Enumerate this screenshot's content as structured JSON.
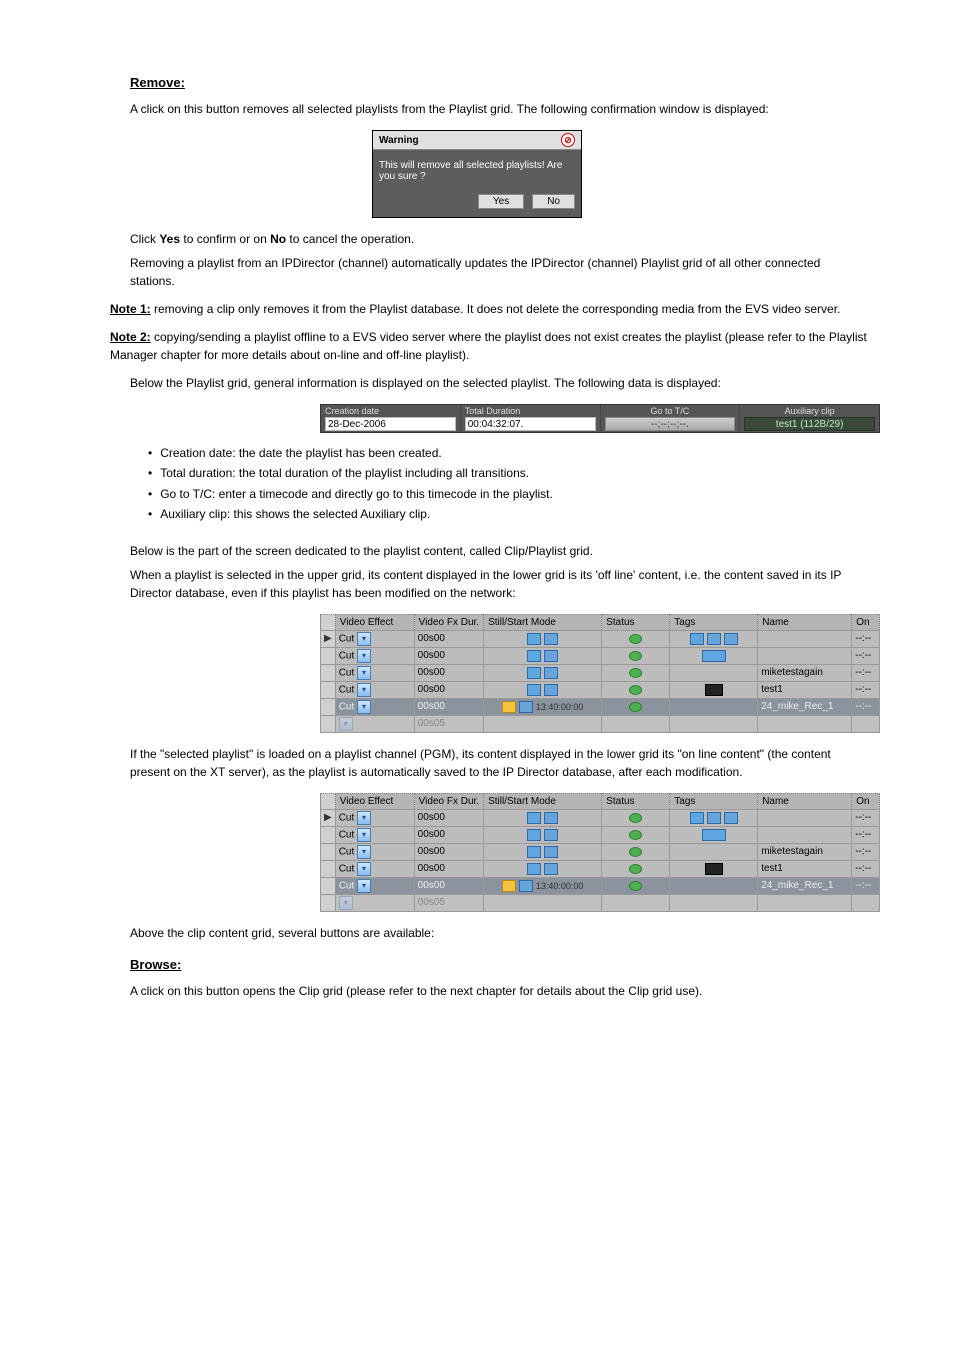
{
  "section_remove": {
    "heading": "Remove:",
    "p1": "A click on this button removes all selected playlists from the Playlist grid. The following confirmation window is displayed:",
    "warning": {
      "title": "Warning",
      "message": "This will remove all selected playlists! Are you sure ?",
      "yes": "Yes",
      "no": "No"
    },
    "p2_1": "Click ",
    "p2_yes": "Yes",
    "p2_2": " to confirm or on ",
    "p2_no": "No",
    "p2_3": " to cancel the operation.",
    "p3": "Removing a playlist from an IPDirector (channel) automatically updates the IPDirector (channel) Playlist grid of all other connected stations.",
    "note1_label": "Note 1:",
    "note1_text": " removing a clip only removes it from the Playlist database. It does not delete the corresponding media from the EVS video server.",
    "note2_label": "Note 2:",
    "note2_text": " copying/sending a playlist offline to a EVS video server where the playlist does not exist creates the playlist (please refer to the Playlist Manager chapter for more details about on-line and off-line playlist).",
    "p4": "Below the Playlist grid, general information is displayed on the selected playlist. The following data is displayed:",
    "infobar": {
      "creation_label": "Creation date",
      "creation_value": "28-Dec-2006",
      "total_label": "Total Duration",
      "total_value": "00:04:32:07.",
      "goto_label": "Go to T/C",
      "goto_value": "--;--;--;--.",
      "aux_label": "Auxiliary clip",
      "aux_value": "test1  (112B/29)"
    },
    "bullets": {
      "b1": "Creation date: the date the playlist has been created.",
      "b2": "Total duration: the total duration of the playlist including all transitions.",
      "b3": "Go to T/C: enter a timecode and directly go to this timecode in the playlist.",
      "b4": "Auxiliary clip: this shows the selected Auxiliary clip."
    }
  },
  "section_playlist": {
    "p1": "Below is the part of the screen dedicated to the playlist content, called Clip/Playlist grid.",
    "p2": "When a playlist is selected in the upper grid, its content displayed in the lower grid is its 'off line' content, i.e. the content saved in its IP Director database, even if this playlist has been modified on the network:",
    "p3": "If the \"selected playlist\" is loaded on a playlist channel (PGM), its content displayed in the lower grid its \"on line content\" (the content present on the XT server), as the playlist is automatically saved to the IP Director database, after each modification.",
    "p4": "Above the clip content grid, several buttons are available:"
  },
  "table": {
    "headers": {
      "video_effect": "Video Effect",
      "video_dur": "Video Fx Dur.",
      "mode": "Still/Start Mode",
      "status": "Status",
      "tags": "Tags",
      "name": "Name",
      "on": "On"
    },
    "rows": [
      {
        "effect": "Cut",
        "dur": "00s00",
        "mode_tc": "",
        "name": "",
        "on": "--:--",
        "sel": false,
        "faint": false
      },
      {
        "effect": "Cut",
        "dur": "00s00",
        "mode_tc": "",
        "name": "",
        "on": "--:--",
        "sel": false,
        "faint": false
      },
      {
        "effect": "Cut",
        "dur": "00s00",
        "mode_tc": "",
        "name": "miketestagain",
        "on": "--:--",
        "sel": false,
        "faint": false
      },
      {
        "effect": "Cut",
        "dur": "00s00",
        "mode_tc": "",
        "name": "test1",
        "on": "--:--",
        "sel": false,
        "faint": false
      },
      {
        "effect": "Cut",
        "dur": "00s00",
        "mode_tc": "13:40:00:00",
        "name": "24_mike_Rec_1",
        "on": "--:--",
        "sel": true,
        "faint": false
      },
      {
        "effect": "",
        "dur": "00s05",
        "mode_tc": "",
        "name": "",
        "on": "",
        "sel": false,
        "faint": true
      }
    ]
  },
  "section_browse": {
    "heading": "Browse:",
    "p1": "A click on this button opens the Clip grid (please refer to the next chapter for details about the Clip grid use)."
  }
}
